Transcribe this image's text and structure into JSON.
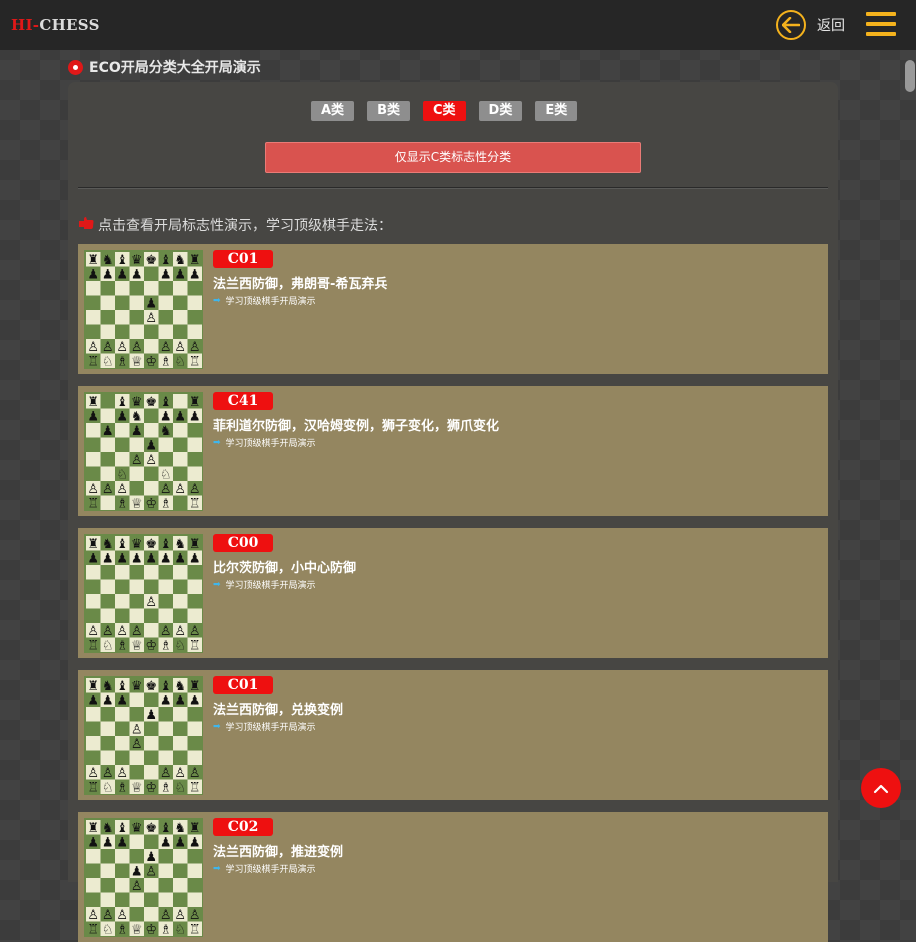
{
  "header": {
    "logo_hi": "HI-",
    "logo_chess": "CHESS",
    "back_label": "返回"
  },
  "section": {
    "title": "ECO开局分类大全开局演示"
  },
  "tabs": [
    {
      "label": "A类",
      "active": false
    },
    {
      "label": "B类",
      "active": false
    },
    {
      "label": "C类",
      "active": true
    },
    {
      "label": "D类",
      "active": false
    },
    {
      "label": "E类",
      "active": false
    }
  ],
  "filter_button": "仅显示C类标志性分类",
  "hint": "点击查看开局标志性演示，学习顶级棋手走法：",
  "openings": [
    {
      "code": "C01",
      "name": "法兰西防御，弗朗哥-希瓦弃兵",
      "link": "学习顶级棋手开局演示"
    },
    {
      "code": "C41",
      "name": "菲利道尔防御，汉哈姆变例，狮子变化，狮爪变化",
      "link": "学习顶级棋手开局演示"
    },
    {
      "code": "C00",
      "name": "比尔茨防御，小中心防御",
      "link": "学习顶级棋手开局演示"
    },
    {
      "code": "C01",
      "name": "法兰西防御，兑换变例",
      "link": "学习顶级棋手开局演示"
    },
    {
      "code": "C02",
      "name": "法兰西防御，推进变例",
      "link": "学习顶级棋手开局演示"
    }
  ],
  "colors": {
    "accent": "#f4b21d",
    "brand_red": "#ee1010",
    "card_bg": "#948660",
    "filter_bg": "#d9534f",
    "board_dark": "#6a8a48",
    "board_light": "#ecebd0"
  },
  "icons": {
    "back": "arrow-left-circle-icon",
    "menu": "hamburger-icon",
    "section": "red-dot-icon",
    "hint": "pointing-hand-icon",
    "link": "arrow-right-icon",
    "top": "chevron-up-icon"
  }
}
